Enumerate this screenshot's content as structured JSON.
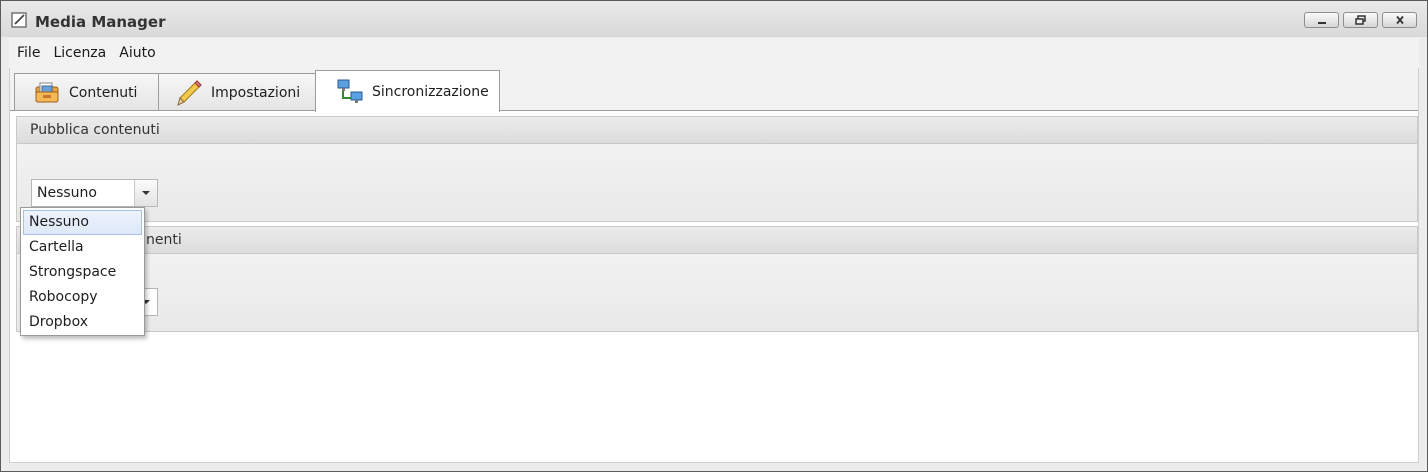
{
  "window": {
    "title": "Media Manager",
    "controls": [
      "minimize",
      "restore",
      "close"
    ]
  },
  "menu": {
    "items": [
      "File",
      "Licenza",
      "Aiuto"
    ]
  },
  "tabs": [
    {
      "label": "Contenuti",
      "icon": "folder-contents-icon"
    },
    {
      "label": "Impostazioni",
      "icon": "pencil-icon"
    },
    {
      "label": "Sincronizzazione",
      "icon": "network-sync-icon",
      "active": true
    }
  ],
  "groups": {
    "publish": {
      "header": "Pubblica contenuti",
      "combo_value": "Nessuno"
    },
    "second": {
      "header_visible_fragment": "nenti"
    }
  },
  "dropdown": {
    "options": [
      "Nessuno",
      "Cartella",
      "Strongspace",
      "Robocopy",
      "Dropbox"
    ],
    "selected": "Nessuno"
  },
  "colors": {
    "selection_bg": "#dde8f8",
    "selection_border": "#a7bfe4",
    "window_border": "#5b5b5b"
  }
}
